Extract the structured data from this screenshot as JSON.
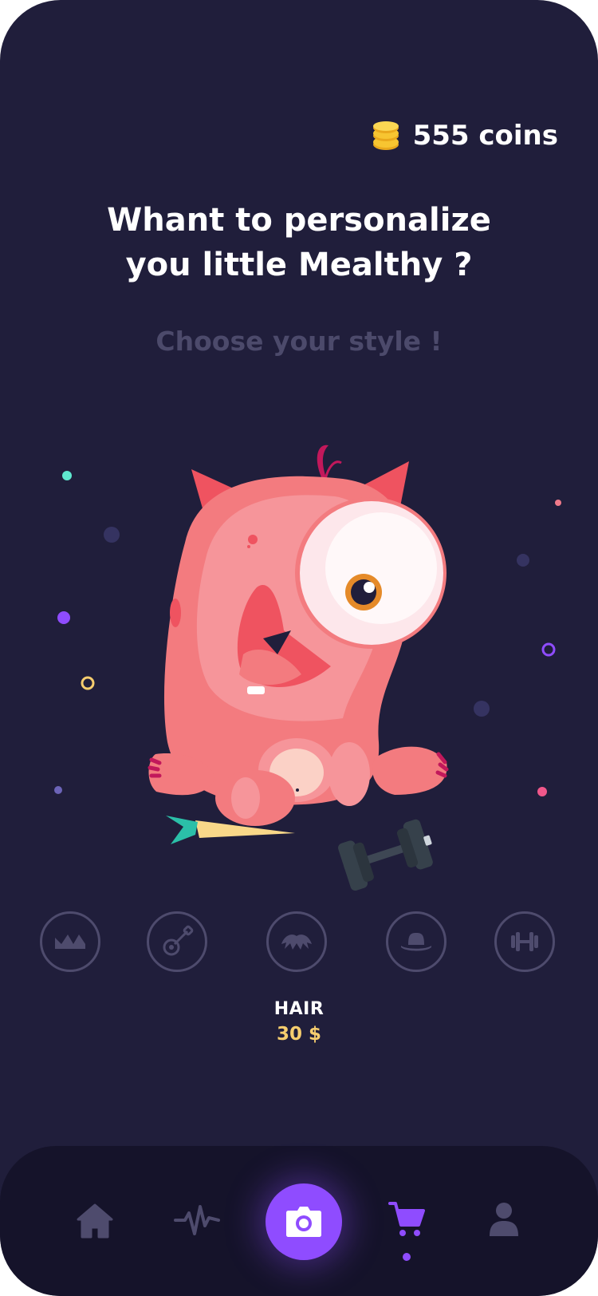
{
  "header": {
    "coins_label": "555 coins"
  },
  "hero": {
    "title_line1": "Whant to personalize",
    "title_line2": "you little Mealthy ?",
    "subtitle": "Choose your style !"
  },
  "options": [
    {
      "icon": "crown-icon"
    },
    {
      "icon": "guitar-icon"
    },
    {
      "icon": "hair-icon",
      "selected": true
    },
    {
      "icon": "hat-icon"
    },
    {
      "icon": "dumbbell-icon"
    }
  ],
  "selected_item": {
    "name": "HAIR",
    "price": "30 $"
  },
  "nav": {
    "items": [
      "home-icon",
      "activity-icon",
      "camera-icon",
      "cart-icon",
      "profile-icon"
    ],
    "active": "cart-icon"
  },
  "colors": {
    "background": "#201e3b",
    "accent": "#8f4cff",
    "price": "#f6cd6e",
    "navbar": "#15132a"
  }
}
